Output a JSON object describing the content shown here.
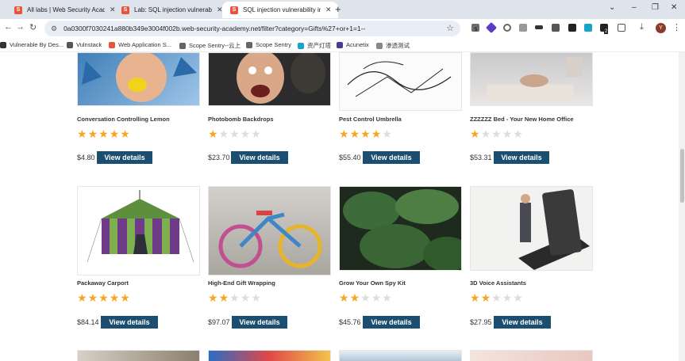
{
  "browser": {
    "tabs": [
      {
        "title": "All labs | Web Security Acade",
        "active": false
      },
      {
        "title": "Lab: SQL injection vulnerabili",
        "active": false
      },
      {
        "title": "SQL injection vulnerability in",
        "active": true
      }
    ],
    "new_tab_symbol": "+",
    "window_controls": [
      "⌄",
      "–",
      "❐",
      "✕"
    ],
    "url": "0a0300f7030241a880b349e3004f002b.web-security-academy.net/filter?category=Gifts%27+or+1=1--",
    "extension_badges": [
      "5",
      "2"
    ],
    "profile_initial": "Y",
    "bookmarks": [
      {
        "label": "Vulnerable By Des...",
        "color": "#333333"
      },
      {
        "label": "Vulnstack",
        "color": "#555555"
      },
      {
        "label": "Web Application S...",
        "color": "#e8553c"
      },
      {
        "label": "Scope Sentry--云上",
        "color": "#666666"
      },
      {
        "label": "Scope Sentry",
        "color": "#666666"
      },
      {
        "label": "资产灯塔",
        "color": "#1aa3c9"
      },
      {
        "label": "Acunetix",
        "color": "#4a3b8f"
      },
      {
        "label": "渗透测试",
        "color": "#888888"
      }
    ]
  },
  "colors": {
    "star_filled": "#f5a623",
    "star_empty": "#dddddd",
    "button": "#1b4f72"
  },
  "products": [
    {
      "name": "Conversation Controlling Lemon",
      "rating": 5,
      "price": "$4.80",
      "button": "View details"
    },
    {
      "name": "Photobomb Backdrops",
      "rating": 1,
      "price": "$23.70",
      "button": "View details"
    },
    {
      "name": "Pest Control Umbrella",
      "rating": 4,
      "price": "$55.40",
      "button": "View details"
    },
    {
      "name": "ZZZZZZ Bed - Your New Home Office",
      "rating": 1,
      "price": "$53.31",
      "button": "View details"
    },
    {
      "name": "Packaway Carport",
      "rating": 5,
      "price": "$84.14",
      "button": "View details"
    },
    {
      "name": "High-End Gift Wrapping",
      "rating": 2,
      "price": "$97.07",
      "button": "View details"
    },
    {
      "name": "Grow Your Own Spy Kit",
      "rating": 2,
      "price": "$45.76",
      "button": "View details"
    },
    {
      "name": "3D Voice Assistants",
      "rating": 2,
      "price": "$27.95",
      "button": "View details"
    }
  ]
}
